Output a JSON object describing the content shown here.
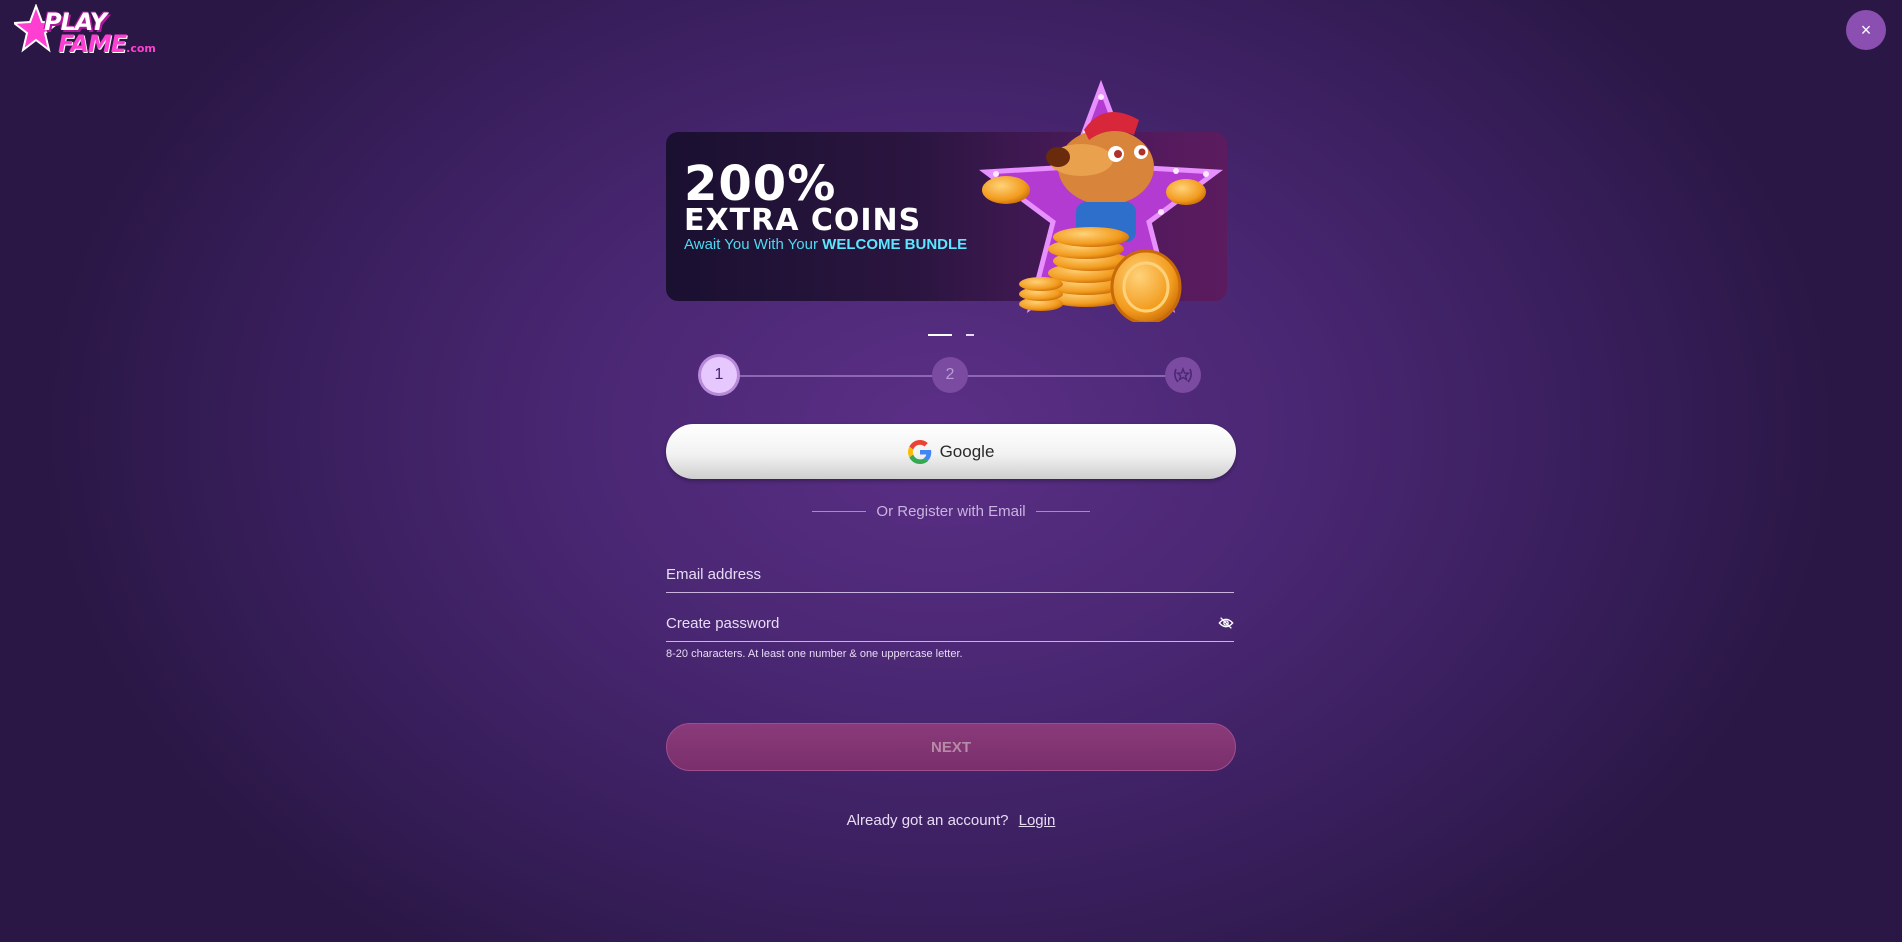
{
  "brand": {
    "play": "PLAY",
    "fame": "FAME",
    "tld": ".com"
  },
  "close_label": "×",
  "banner": {
    "percent": "200%",
    "headline": "EXTRA COINS",
    "sub_prefix": "Await You With Your ",
    "sub_highlight": "WELCOME BUNDLE"
  },
  "stepper": {
    "step1": "1",
    "step2": "2"
  },
  "google": {
    "label": "Google"
  },
  "divider": {
    "text": "Or Register with Email"
  },
  "email": {
    "placeholder": "Email address"
  },
  "password": {
    "placeholder": "Create password",
    "hint": "8-20 characters. At least one number & one uppercase letter."
  },
  "next": {
    "label": "NEXT"
  },
  "login": {
    "prompt": "Already got an account?",
    "link": "Login"
  },
  "colors": {
    "background": "#4a2773",
    "accent_cyan": "#4fd8f0",
    "next_button": "#7a2f6c",
    "step_active": "#e6c8ff"
  }
}
